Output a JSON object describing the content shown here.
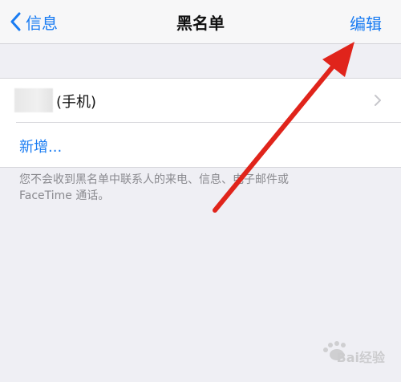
{
  "nav": {
    "back_label": "信息",
    "title": "黑名单",
    "edit_label": "编辑"
  },
  "list": {
    "contact_label": "(手机)",
    "add_label": "新增..."
  },
  "footer": {
    "line1": "您不会收到黑名单中联系人的来电、信息、电子邮件或",
    "line2": "FaceTime 通话。"
  },
  "watermark": {
    "text": "Bai经验"
  },
  "colors": {
    "accent": "#1a7cf2",
    "annotation": "#e0241b"
  },
  "icons": {
    "back": "chevron-left-icon",
    "row_disclosure": "chevron-right-icon",
    "annotation": "red-arrow-icon"
  }
}
